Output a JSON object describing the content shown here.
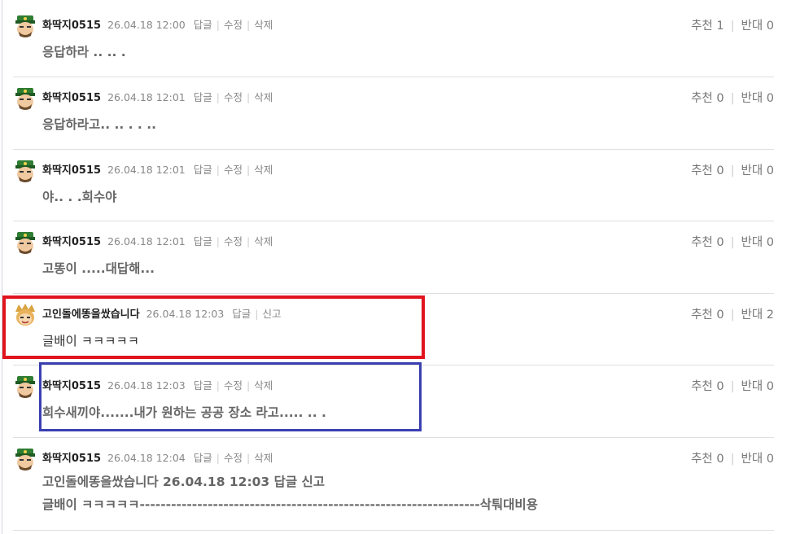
{
  "comments": [
    {
      "nick": "화딱지0515",
      "date": "26.04.18 12:00",
      "actions": [
        "답글",
        "수정",
        "삭제"
      ],
      "up_label": "추천 1",
      "down_label": "반대 0",
      "text": "응답하라 .. .. ."
    },
    {
      "nick": "화딱지0515",
      "date": "26.04.18 12:01",
      "actions": [
        "답글",
        "수정",
        "삭제"
      ],
      "up_label": "추천 0",
      "down_label": "반대 0",
      "text": "응답하라고.. .. . . .."
    },
    {
      "nick": "화딱지0515",
      "date": "26.04.18 12:01",
      "actions": [
        "답글",
        "수정",
        "삭제"
      ],
      "up_label": "추천 0",
      "down_label": "반대 0",
      "text": "야.. . .희수야"
    },
    {
      "nick": "화딱지0515",
      "date": "26.04.18 12:01",
      "actions": [
        "답글",
        "수정",
        "삭제"
      ],
      "up_label": "추천 0",
      "down_label": "반대 0",
      "text": "고똥이 .....대답해..."
    },
    {
      "nick": "고인돌에똥을쌌습니다",
      "date": "26.04.18 12:03",
      "actions": [
        "답글",
        "신고"
      ],
      "up_label": "추천 0",
      "down_label": "반대 2",
      "text": "글배이 ㅋㅋㅋㅋㅋ"
    },
    {
      "nick": "화딱지0515",
      "date": "26.04.18 12:03",
      "actions": [
        "답글",
        "수정",
        "삭제"
      ],
      "up_label": "추천 0",
      "down_label": "반대 0",
      "text": "희수새끼야.......내가 원하는 공공 장소 라고..... .. ."
    },
    {
      "nick": "화딱지0515",
      "date": "26.04.18 12:04",
      "actions": [
        "답글",
        "수정",
        "삭제"
      ],
      "up_label": "추천 0",
      "down_label": "반대 0",
      "text": "고인돌에똥을쌌습니다 26.04.18 12:03 답글 신고",
      "text2": "글배이 ㅋㅋㅋㅋㅋ-----------------------------------------------------------------삭퉈대비용"
    }
  ],
  "colors": {
    "highlight_red": "#e1141e",
    "highlight_blue": "#3a3fb0",
    "avatar_military": "#2f7d32",
    "avatar_gold": "#d9a441"
  }
}
